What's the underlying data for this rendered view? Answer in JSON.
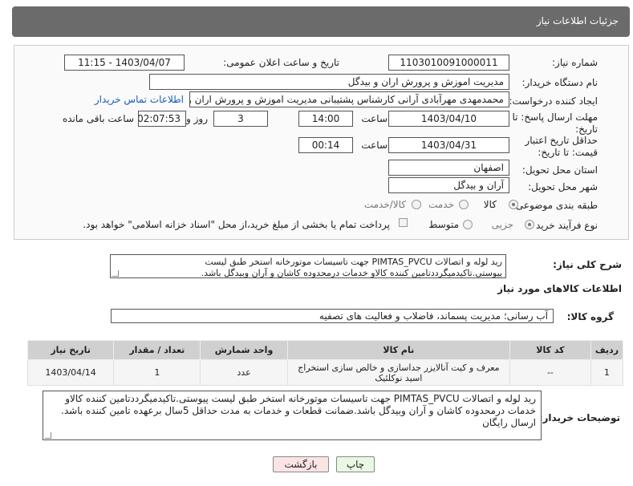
{
  "header": {
    "title": "جزئیات اطلاعات نیاز"
  },
  "form": {
    "need_number_label": "شماره نیاز:",
    "need_number": "1103010091000011",
    "announce_label": "تاریخ و ساعت اعلان عمومی:",
    "announce_value": "1403/04/07 - 11:15",
    "buyer_org_label": "نام دستگاه خریدار:",
    "buyer_org": "مدیریت اموزش و پرورش اران و بیدگل",
    "creator_label": "ایجاد کننده درخواست:",
    "creator": "محمدمهدی مهرآبادی آرانی کارشناس پشتیبانی مدیریت اموزش و پرورش اران و بیدگل",
    "contact_link": "اطلاعات تماس خریدار",
    "reply_deadline_label": "مهلت ارسال پاسخ: تا تاریخ:",
    "reply_date": "1403/04/10",
    "time_label": "ساعت",
    "reply_time": "14:00",
    "days_value": "3",
    "days_label": "روز و",
    "remaining_time": "02:07:53",
    "remaining_label": "ساعت باقی مانده",
    "validity_label": "حداقل تاریخ اعتبار قیمت: تا تاریخ:",
    "validity_date": "1403/04/31",
    "validity_time_label": "ساعت",
    "validity_time": "00:14",
    "province_label": "استان محل تحویل:",
    "province": "اصفهان",
    "city_label": "شهر محل تحویل:",
    "city": "آران و بیدگل",
    "category_label": "طبقه بندی موضوعی:",
    "category_options": [
      "کالا",
      "خدمت",
      "کالا/خدمت"
    ],
    "process_label": "نوع فرآیند خرید :",
    "process_options": [
      "جزیی",
      "متوسط"
    ],
    "process_note": "پرداخت تمام یا بخشی از مبلغ خرید،از محل \"اسناد خزانه اسلامی\" خواهد بود."
  },
  "summary": {
    "label": "شرح کلی نیاز:",
    "text": "رید لوله و اتصالات PIMTAS_PVCU جهت تاسیسات موتورخانه استخر طبق لیست پیوستی.تاکیدمیگرددتامین کننده کالاو خدمات درمحدوده کاشان و آران وبیدگل باشد."
  },
  "items_section": {
    "title": "اطلاعات کالاهای مورد نیاز",
    "group_label": "گروه کالا:",
    "group_value": "آب رسانی؛ مدیریت پسماند، فاضلاب و فعالیت های تصفیه",
    "columns": [
      "ردیف",
      "کد کالا",
      "نام کالا",
      "واحد شمارش",
      "تعداد / مقدار",
      "تاریخ نیاز"
    ],
    "rows": [
      [
        "1",
        "--",
        "معرف و کیت آنالایزر جداسازی و خالص سازی استخراج اسید نوکلئیک",
        "عدد",
        "1",
        "1403/04/14"
      ]
    ]
  },
  "buyer_notes": {
    "label": "توضیحات خریدار:",
    "text": "رید لوله و اتصالات PIMTAS_PVCU جهت تاسیسات موتورخانه استخر طبق لیست پیوستی.تاکیدمیگرددتامین کننده کالاو خدمات درمحدوده کاشان و آران وبیدگل باشد.ضمانت قطعات و خدمات به مدت حداقل 5سال برعهده تامین کننده باشد. ارسال رایگان"
  },
  "buttons": {
    "print": "چاپ",
    "back": "بازگشت"
  }
}
